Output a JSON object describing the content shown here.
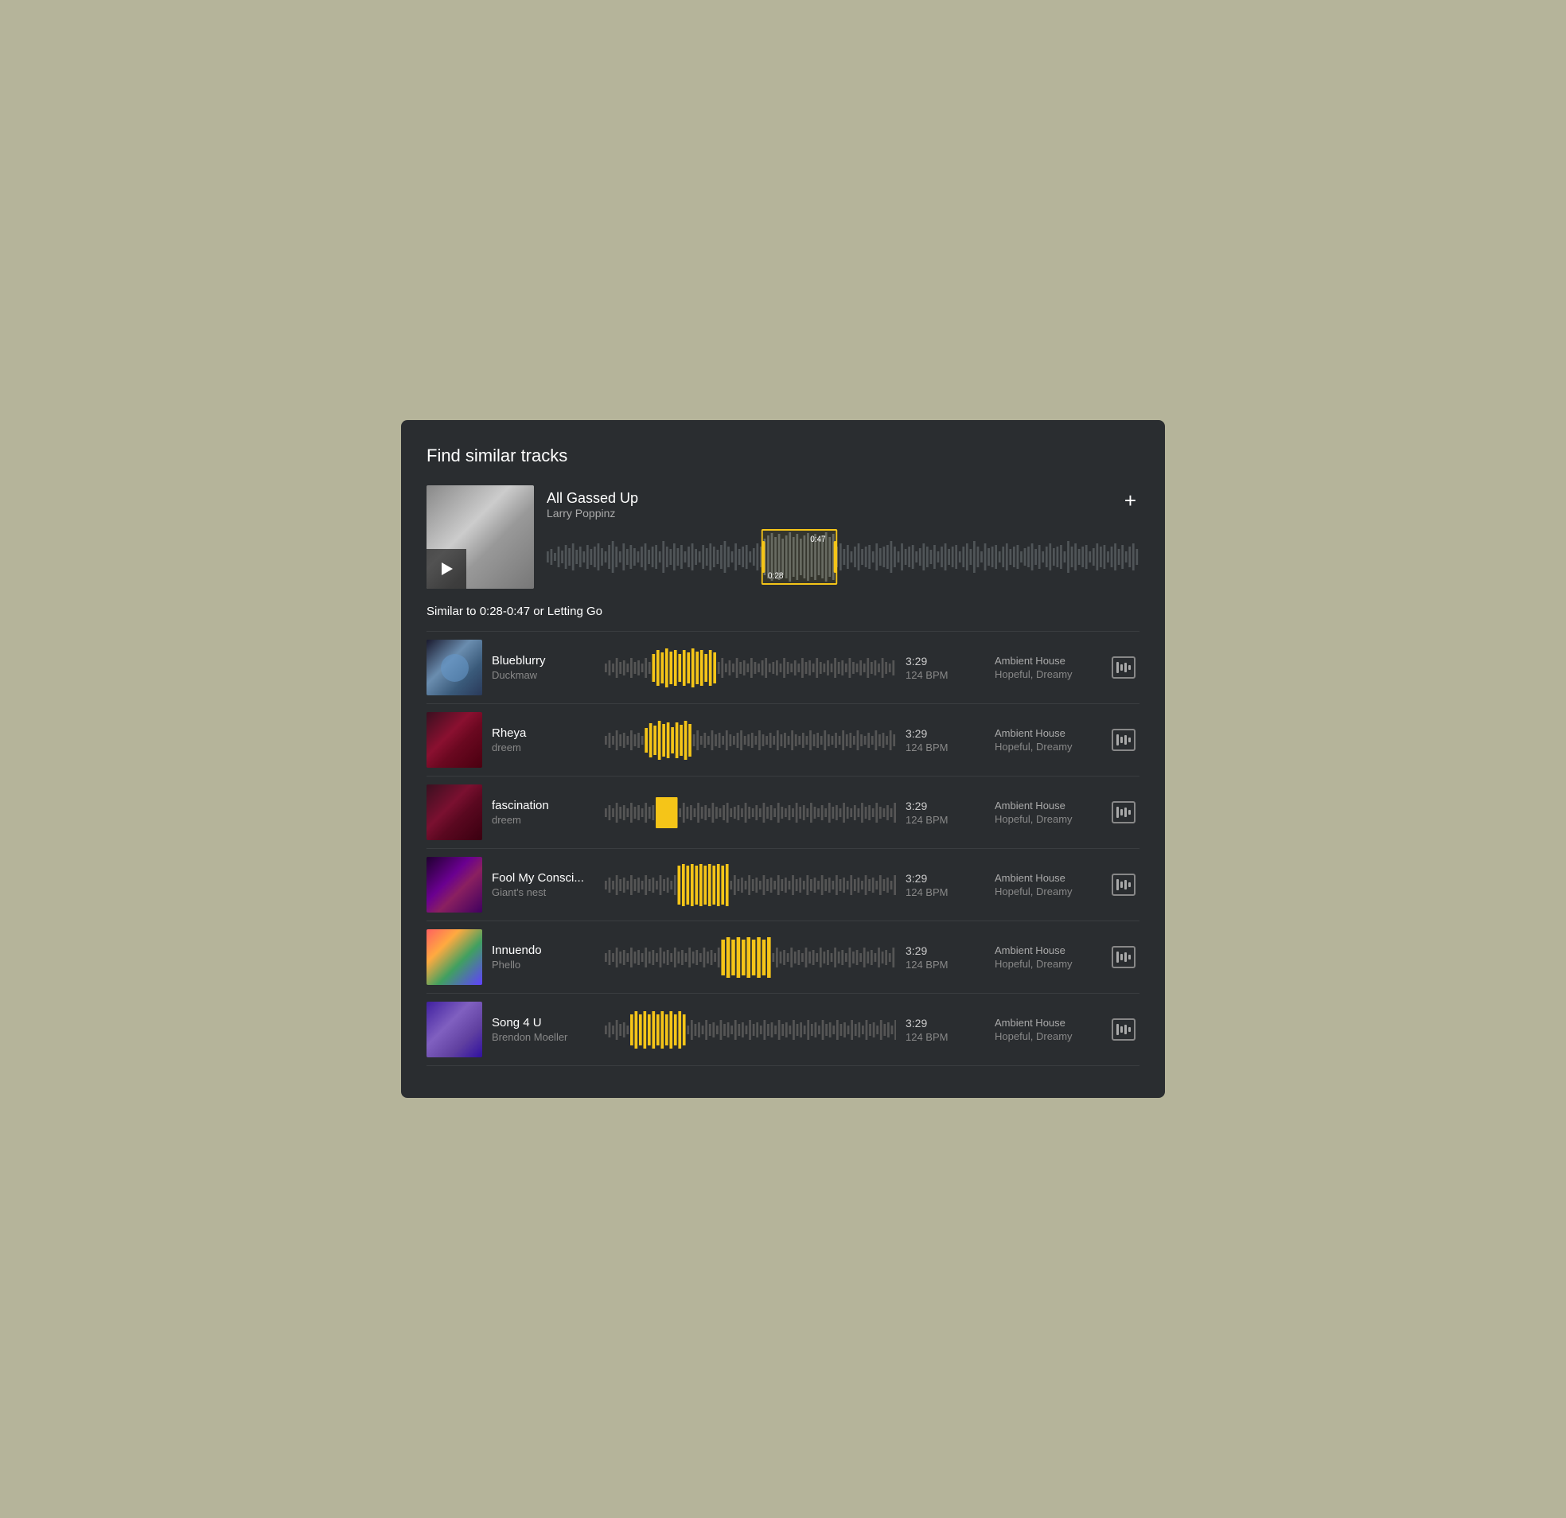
{
  "page": {
    "title": "Find similar tracks",
    "background": "#b5b49a",
    "window_bg": "#2a2d30"
  },
  "featured_track": {
    "title": "All Gassed Up",
    "artist": "Larry Poppinz",
    "selection_start": "0:28",
    "selection_end": "0:47",
    "add_label": "+"
  },
  "similar_label": {
    "prefix": "Similar to ",
    "time_range": "0:28-0:47",
    "middle": " or ",
    "keyword": "Letting Go"
  },
  "tracks": [
    {
      "id": "blueblurry",
      "title": "Blueblurry",
      "artist": "Duckmaw",
      "duration": "3:29",
      "bpm": "124 BPM",
      "genre": "Ambient House",
      "mood": "Hopeful, Dreamy",
      "highlight_position": "early"
    },
    {
      "id": "rheya",
      "title": "Rheya",
      "artist": "dreem",
      "duration": "3:29",
      "bpm": "124 BPM",
      "genre": "Ambient House",
      "mood": "Hopeful, Dreamy",
      "highlight_position": "early"
    },
    {
      "id": "fascination",
      "title": "fascination",
      "artist": "dreem",
      "duration": "3:29",
      "bpm": "124 BPM",
      "genre": "Ambient House",
      "mood": "Hopeful, Dreamy",
      "highlight_position": "early-mid"
    },
    {
      "id": "fool",
      "title": "Fool My Consci...",
      "artist": "Giant's nest",
      "duration": "3:29",
      "bpm": "124 BPM",
      "genre": "Ambient House",
      "mood": "Hopeful, Dreamy",
      "highlight_position": "mid"
    },
    {
      "id": "innuendo",
      "title": "Innuendo",
      "artist": "Phello",
      "duration": "3:29",
      "bpm": "124 BPM",
      "genre": "Ambient House",
      "mood": "Hopeful, Dreamy",
      "highlight_position": "mid-late"
    },
    {
      "id": "song4u",
      "title": "Song 4 U",
      "artist": "Brendon Moeller",
      "duration": "3:29",
      "bpm": "124 BPM",
      "genre": "Ambient House",
      "mood": "Hopeful, Dreamy",
      "highlight_position": "early"
    }
  ]
}
